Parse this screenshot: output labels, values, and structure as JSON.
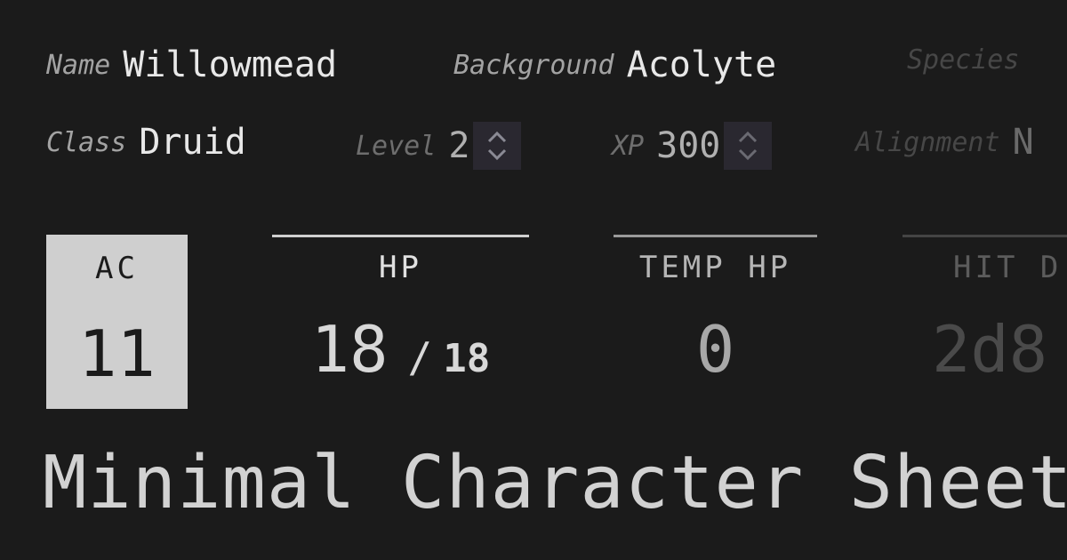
{
  "row1": {
    "name": {
      "label": "Name",
      "value": "Willowmead"
    },
    "background": {
      "label": "Background",
      "value": "Acolyte"
    },
    "species": {
      "label": "Species",
      "value": ""
    }
  },
  "row2": {
    "class": {
      "label": "Class",
      "value": "Druid"
    },
    "level": {
      "label": "Level",
      "value": "2"
    },
    "xp": {
      "label": "XP",
      "value": "300"
    },
    "alignment": {
      "label": "Alignment",
      "value": "N"
    }
  },
  "stats": {
    "ac": {
      "label": "AC",
      "value": "11"
    },
    "hp": {
      "label": "HP",
      "current": "18",
      "separator": "/",
      "max": "18"
    },
    "temp_hp": {
      "label": "TEMP HP",
      "value": "0"
    },
    "hit_dice": {
      "label": "HIT D",
      "value": "2d8"
    }
  },
  "title": "Minimal Character Sheet",
  "icons": {
    "stepper": "chevron-up-down-icon"
  },
  "colors": {
    "background": "#1b1b1b",
    "text": "#e8e8e8",
    "muted_label": "#a3a3a3",
    "ac_box": "#cfcfcf",
    "stepper_bg": "#2a2830"
  }
}
